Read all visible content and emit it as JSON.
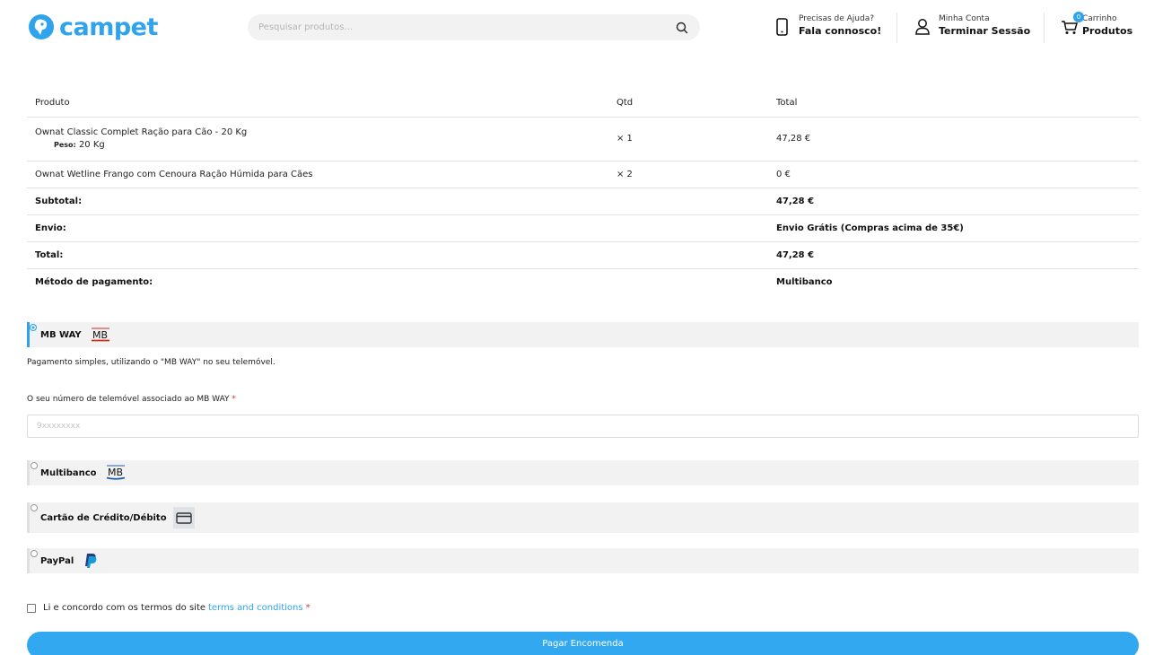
{
  "brand": {
    "name": "campet",
    "accent": "#2fa3ec"
  },
  "search": {
    "placeholder": "Pesquisar produtos...",
    "value": ""
  },
  "header": {
    "help": {
      "small": "Precisas de Ajuda?",
      "big": "Fala connosco!",
      "icon": "phone-icon"
    },
    "account": {
      "small": "Minha Conta",
      "big": "Terminar Sessão",
      "icon": "user-icon"
    },
    "cart": {
      "small": "Carrinho",
      "big": "Produtos",
      "count": "0",
      "icon": "cart-icon"
    }
  },
  "order": {
    "headers": {
      "product": "Produto",
      "qty": "Qtd",
      "total": "Total"
    },
    "items": [
      {
        "name": "Ownat Classic Complet Ração para Cão - 20 Kg",
        "meta_label": "Peso:",
        "meta_value": "20 Kg",
        "qty": "× 1",
        "total": "47,28 €"
      },
      {
        "name": "Ownat Wetline Frango com Cenoura Ração Húmida para Cães",
        "qty": "× 2",
        "total": "0 €"
      }
    ],
    "subtotal": {
      "label": "Subtotal:",
      "value": "47,28 €"
    },
    "shipping": {
      "label": "Envio:",
      "value": "Envio Grátis (Compras acima de 35€)"
    },
    "total": {
      "label": "Total:",
      "value": "47,28 €"
    },
    "payment_method": {
      "label": "Método de pagamento:",
      "value": "Multibanco"
    }
  },
  "payment": {
    "mbway": {
      "label": "MB WAY",
      "logo": "MB",
      "selected": true
    },
    "mbway_description": "Pagamento simples, utilizando o \"MB WAY\" no seu telemóvel.",
    "phone_label": "O seu número de telemóvel associado ao MB WAY",
    "required_mark": "*",
    "phone_placeholder": "9xxxxxxxx",
    "multibanco": {
      "label": "Multibanco",
      "logo": "MB"
    },
    "card": {
      "label": "Cartão de Crédito/Débito",
      "icon": "credit-card-icon"
    },
    "paypal": {
      "label": "PayPal",
      "icon": "paypal-icon"
    }
  },
  "terms": {
    "text": "Li e concordo com os termos do site",
    "link": "terms and conditions",
    "required_mark": "*"
  },
  "pay_button": "Pagar Encomenda"
}
